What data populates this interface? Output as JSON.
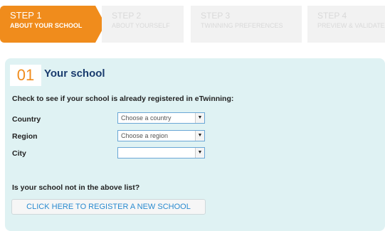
{
  "steps": [
    {
      "number": "STEP 1",
      "label": "ABOUT YOUR SCHOOL"
    },
    {
      "number": "STEP 2",
      "label": "ABOUT YOURSELF"
    },
    {
      "number": "STEP 3",
      "label": "TWINNING PREFERENCES"
    },
    {
      "number": "STEP 4",
      "label": "PREVIEW & VALIDATE"
    }
  ],
  "colors": {
    "accent": "#f08c1c",
    "panel": "#dff2f3",
    "title": "#1a3c6e",
    "link": "#2a8bd0"
  },
  "section": {
    "number": "01",
    "title": "Your school",
    "intro": "Check to see if your school is already registered in eTwinning:"
  },
  "fields": {
    "country": {
      "label": "Country",
      "value": "Choose a country"
    },
    "region": {
      "label": "Region",
      "value": "Choose a region"
    },
    "city": {
      "label": "City",
      "value": ""
    }
  },
  "not_listed": {
    "question": "Is your school not in the above list?",
    "button_label": "CLICK HERE TO REGISTER A NEW SCHOOL"
  }
}
